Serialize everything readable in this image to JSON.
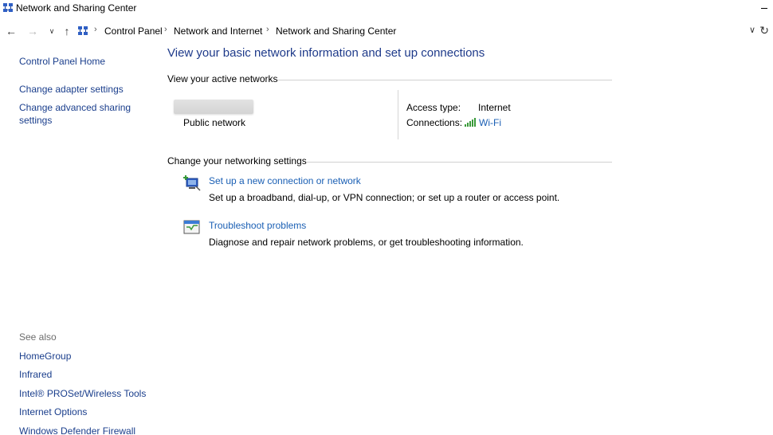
{
  "window": {
    "title": "Network and Sharing Center"
  },
  "address_bar": {
    "breadcrumbs": [
      "Control Panel",
      "Network and Internet",
      "Network and Sharing Center"
    ]
  },
  "left_pane": {
    "home": "Control Panel Home",
    "links": [
      "Change adapter settings",
      "Change advanced sharing",
      "settings"
    ],
    "see_also_label": "See also",
    "see_also": [
      "HomeGroup",
      "Infrared",
      "Intel® PROSet/Wireless Tools",
      "Internet Options",
      "Windows Defender Firewall"
    ]
  },
  "main": {
    "title": "View your basic network information and set up connections",
    "active_networks_header": "View your active networks",
    "network_type": "Public network",
    "access_type_label": "Access type:",
    "access_type_value": "Internet",
    "connections_label": "Connections:",
    "connections_value": "Wi-Fi",
    "change_settings_header": "Change your networking settings",
    "tasks": [
      {
        "link": "Set up a new connection or network",
        "desc": "Set up a broadband, dial-up, or VPN connection; or set up a router or access point.",
        "icon": "new-connection-icon"
      },
      {
        "link": "Troubleshoot problems",
        "desc": "Diagnose and repair network problems, or get troubleshooting information.",
        "icon": "troubleshoot-icon"
      }
    ]
  },
  "colors": {
    "link": "#1a5fb4",
    "left_link": "#1a3e8c",
    "title": "#1e3a8a"
  }
}
